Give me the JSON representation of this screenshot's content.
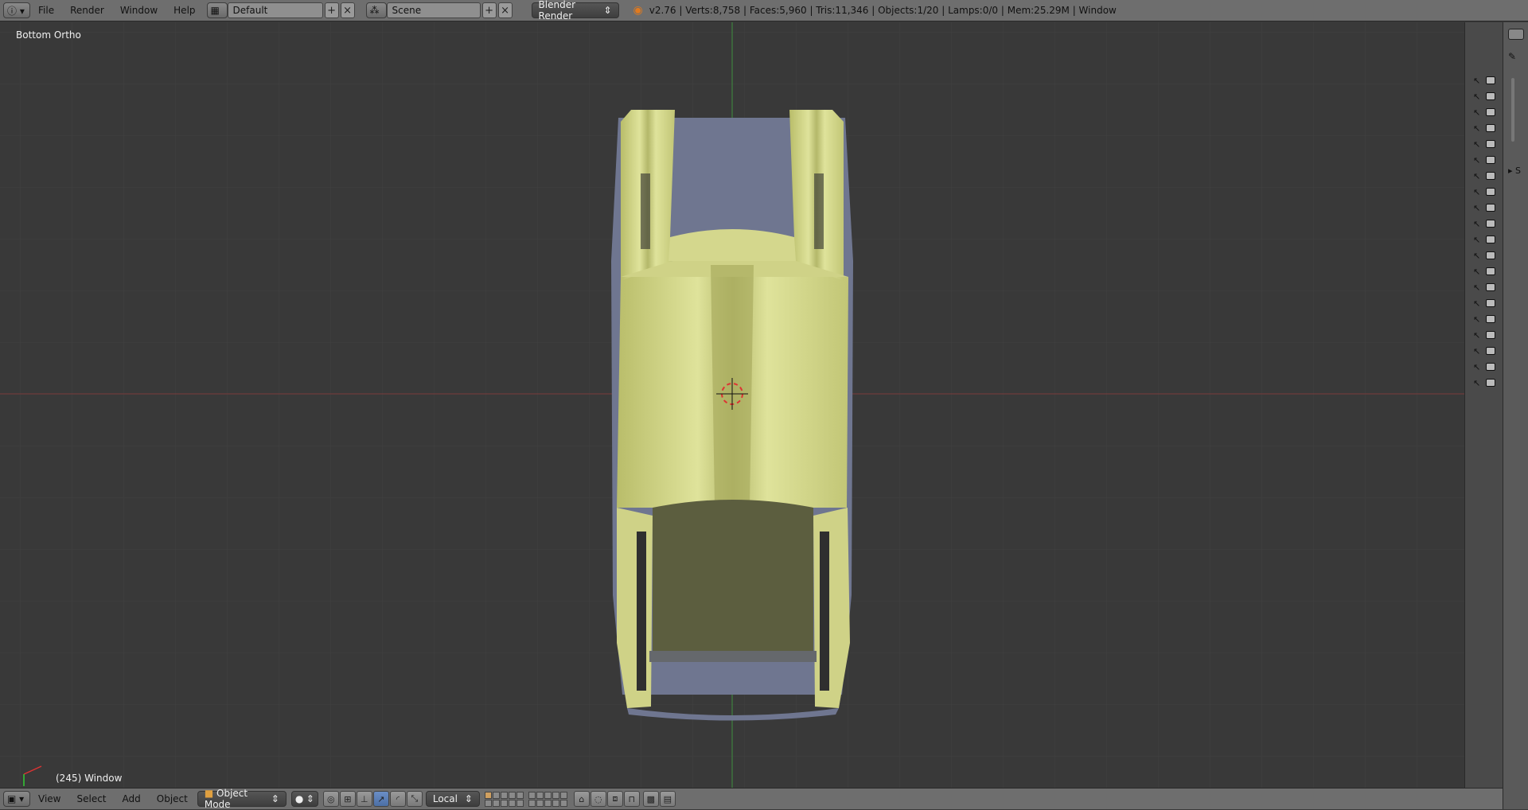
{
  "topbar": {
    "menus": [
      "File",
      "Render",
      "Window",
      "Help"
    ],
    "layout_name": "Default",
    "scene_name": "Scene",
    "render_engine": "Blender Render",
    "stats": "v2.76 | Verts:8,758 | Faces:5,960 | Tris:11,346 | Objects:1/20 | Lamps:0/0 | Mem:25.29M | Window"
  },
  "viewport": {
    "view_name": "Bottom Ortho",
    "frame_info": "(245) Window"
  },
  "bottombar": {
    "menus": [
      "View",
      "Select",
      "Add",
      "Object"
    ],
    "mode": "Object Mode",
    "pivot": "Local"
  },
  "colors": {
    "background": "#393939",
    "header": "#6e6e6e",
    "mesh": "#d6d98c",
    "x_axis": "#8a3a3a",
    "y_axis": "#3f8f3f"
  },
  "outliner_side_label": "S"
}
